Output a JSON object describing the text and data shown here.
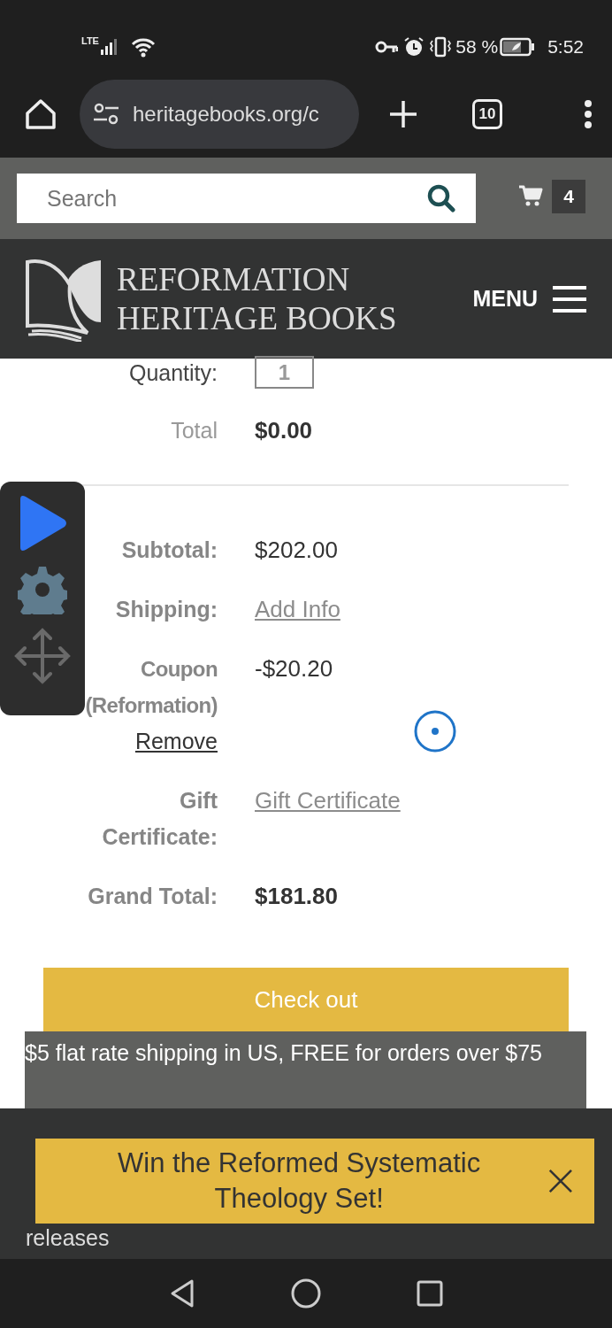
{
  "status_bar": {
    "network": "LTE",
    "battery": "58 %",
    "time": "5:52"
  },
  "browser": {
    "url": "heritagebooks.org/c",
    "tab_count": "10"
  },
  "site_header": {
    "search": {
      "placeholder": "Search"
    },
    "cart_count": "4",
    "logo_line1": "REFORMATION",
    "logo_line2": "HERITAGE BOOKS",
    "menu_label": "MENU"
  },
  "product": {
    "quantity_label": "Quantity:",
    "quantity_value": "1",
    "total_label": "Total",
    "total_value": "$0.00"
  },
  "summary": [
    {
      "kind": "text",
      "label": "Subtotal:",
      "value": "$202.00"
    },
    {
      "kind": "link",
      "label": "Shipping:",
      "value": "Add Info"
    },
    {
      "kind": "coupon",
      "label": "Coupon (Reformation)",
      "value": "-$20.20",
      "action": "Remove"
    },
    {
      "kind": "link",
      "label": "Gift Certificate:",
      "value": "Gift Certificate"
    },
    {
      "kind": "total",
      "label": "Grand Total:",
      "value": "$181.80"
    }
  ],
  "checkout_button": "Check out",
  "shipping_note": "$5 flat rate shipping in US, FREE for orders over $75",
  "footer_lines": [
    "releases"
  ],
  "promo_banner": {
    "text": "Win the Reformed Systematic Theology Set!"
  }
}
